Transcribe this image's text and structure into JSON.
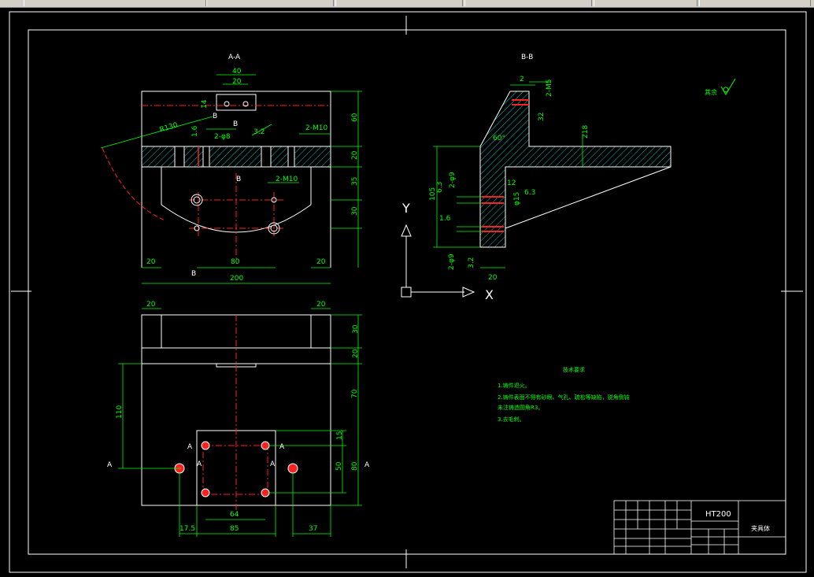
{
  "toolbar": {
    "icons": [
      "layer-icon",
      "sun-icon",
      "lock-icon",
      "color-icon",
      "properties-icon"
    ]
  },
  "drawing": {
    "view_aa": {
      "title": "A-A",
      "dims": [
        "40",
        "20",
        "14",
        "60",
        "20",
        "35",
        "30",
        "80",
        "20",
        "20",
        "200",
        "R130",
        "2-M10",
        "2-M10",
        "2-φ8",
        "1.6",
        "3.2"
      ],
      "section_marks": [
        "B",
        "B",
        "B",
        "B"
      ]
    },
    "view_bb": {
      "title": "B-B",
      "dims": [
        "2",
        "2-M5",
        "32",
        "60°",
        "218",
        "12",
        "105",
        "2-φ9",
        "6.3",
        "6.3",
        "φ15",
        "1.6",
        "3.2",
        "2-φ9",
        "20"
      ],
      "axis_y": "Y",
      "axis_x": "X"
    },
    "view_bottom": {
      "dims": [
        "20",
        "20",
        "30",
        "20",
        "110",
        "70",
        "15",
        "50",
        "80",
        "17.5",
        "85",
        "64",
        "37"
      ],
      "section_marks": [
        "A",
        "A",
        "A",
        "A",
        "A",
        "A"
      ]
    },
    "roughness_note": "其余",
    "tech_requirements": {
      "title": "技术要求",
      "lines": [
        "1.铸件退火。",
        "2.铸件表面不得有砂眼、气孔、疏松等缺陷，锐角倒钝",
        "未注铸造圆角R3。",
        "3.去毛刺。"
      ]
    },
    "title_block": {
      "material": "HT200",
      "part_name": "夹具体"
    }
  }
}
